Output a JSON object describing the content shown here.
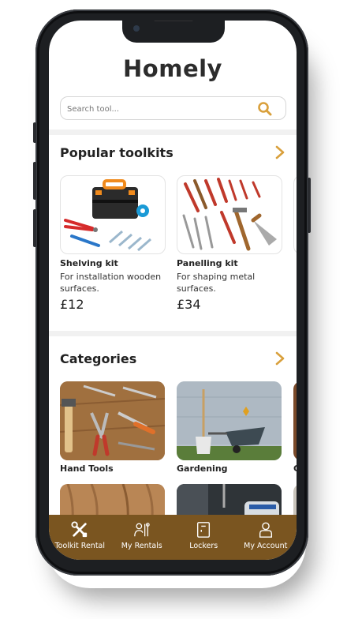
{
  "app": {
    "logo": "Homely"
  },
  "search": {
    "placeholder": "Search tool..."
  },
  "popular": {
    "title": "Popular toolkits",
    "items": [
      {
        "name": "Shelving kit",
        "desc": "For installation wooden surfaces.",
        "price": "£12"
      },
      {
        "name": "Panelling kit",
        "desc": "For shaping metal surfaces.",
        "price": "£34"
      }
    ]
  },
  "categories": {
    "title": "Categories",
    "items": [
      {
        "label": "Hand Tools"
      },
      {
        "label": "Gardening"
      },
      {
        "label": "G"
      }
    ]
  },
  "tabbar": {
    "tabs": [
      {
        "label": "Toolkit Rental",
        "icon": "tools-icon"
      },
      {
        "label": "My Rentals",
        "icon": "person-tools-icon"
      },
      {
        "label": "Lockers",
        "icon": "locker-icon"
      },
      {
        "label": "My Account",
        "icon": "user-icon"
      }
    ]
  },
  "colors": {
    "accent": "#d9a03c",
    "tabbar": "#7a5520"
  }
}
